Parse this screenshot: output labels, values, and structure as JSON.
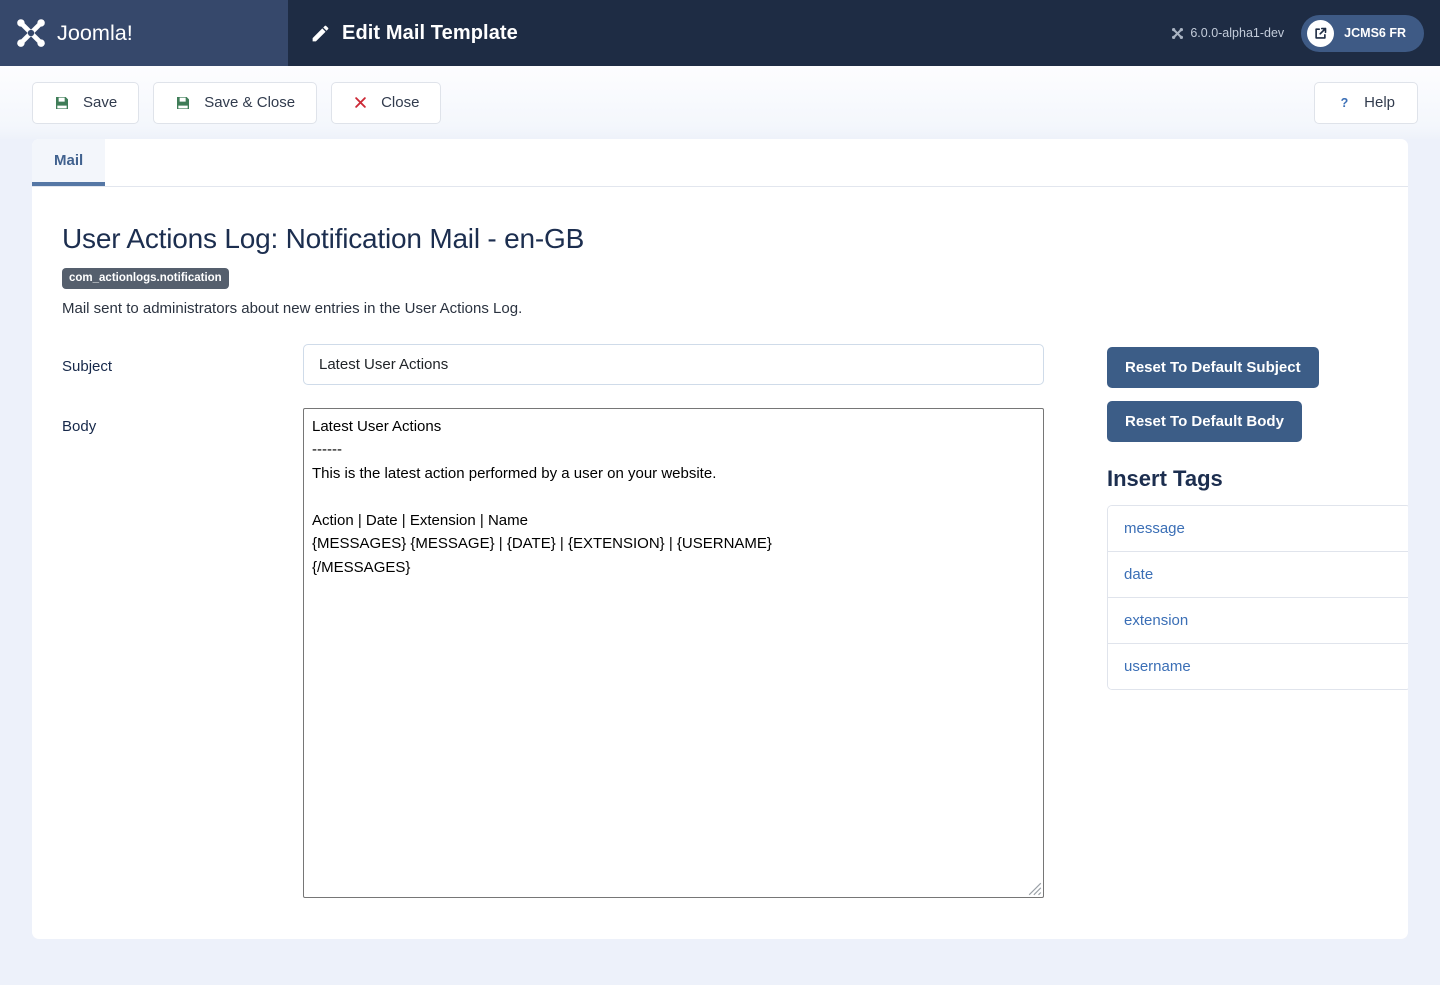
{
  "header": {
    "brand_name": "Joomla!",
    "title": "Edit Mail Template",
    "version": "6.0.0-alpha1-dev",
    "site_label": "JCMS6 FR",
    "brand_bg": "#36486b",
    "bar_bg": "#1e2c44"
  },
  "toolbar": {
    "save_label": "Save",
    "save_close_label": "Save & Close",
    "close_label": "Close",
    "help_label": "Help",
    "save_icon_color": "#3f7d58",
    "close_icon_color": "#cc2936",
    "help_icon_color": "#3b6fb6"
  },
  "tabs": [
    {
      "label": "Mail",
      "active": true
    }
  ],
  "page": {
    "title": "User Actions Log: Notification Mail - en-GB",
    "key_badge": "com_actionlogs.notification",
    "description": "Mail sent to administrators about new entries in the User Actions Log."
  },
  "form": {
    "subject_label": "Subject",
    "subject_value": "Latest User Actions",
    "subject_placeholder": "",
    "body_label": "Body",
    "body_value": "Latest User Actions\n------\nThis is the latest action performed by a user on your website.\n\nAction | Date | Extension | Name\n{MESSAGES} {MESSAGE} | {DATE} | {EXTENSION} | {USERNAME}\n{/MESSAGES}",
    "body_placeholder": ""
  },
  "side_panel": {
    "reset_subject_label": "Reset To Default Subject",
    "reset_body_label": "Reset To Default Body",
    "insert_tags_heading": "Insert Tags",
    "tags": [
      {
        "label": "message"
      },
      {
        "label": "date"
      },
      {
        "label": "extension"
      },
      {
        "label": "username"
      }
    ],
    "button_color": "#3c5d87",
    "link_color": "#3b6fb6"
  }
}
